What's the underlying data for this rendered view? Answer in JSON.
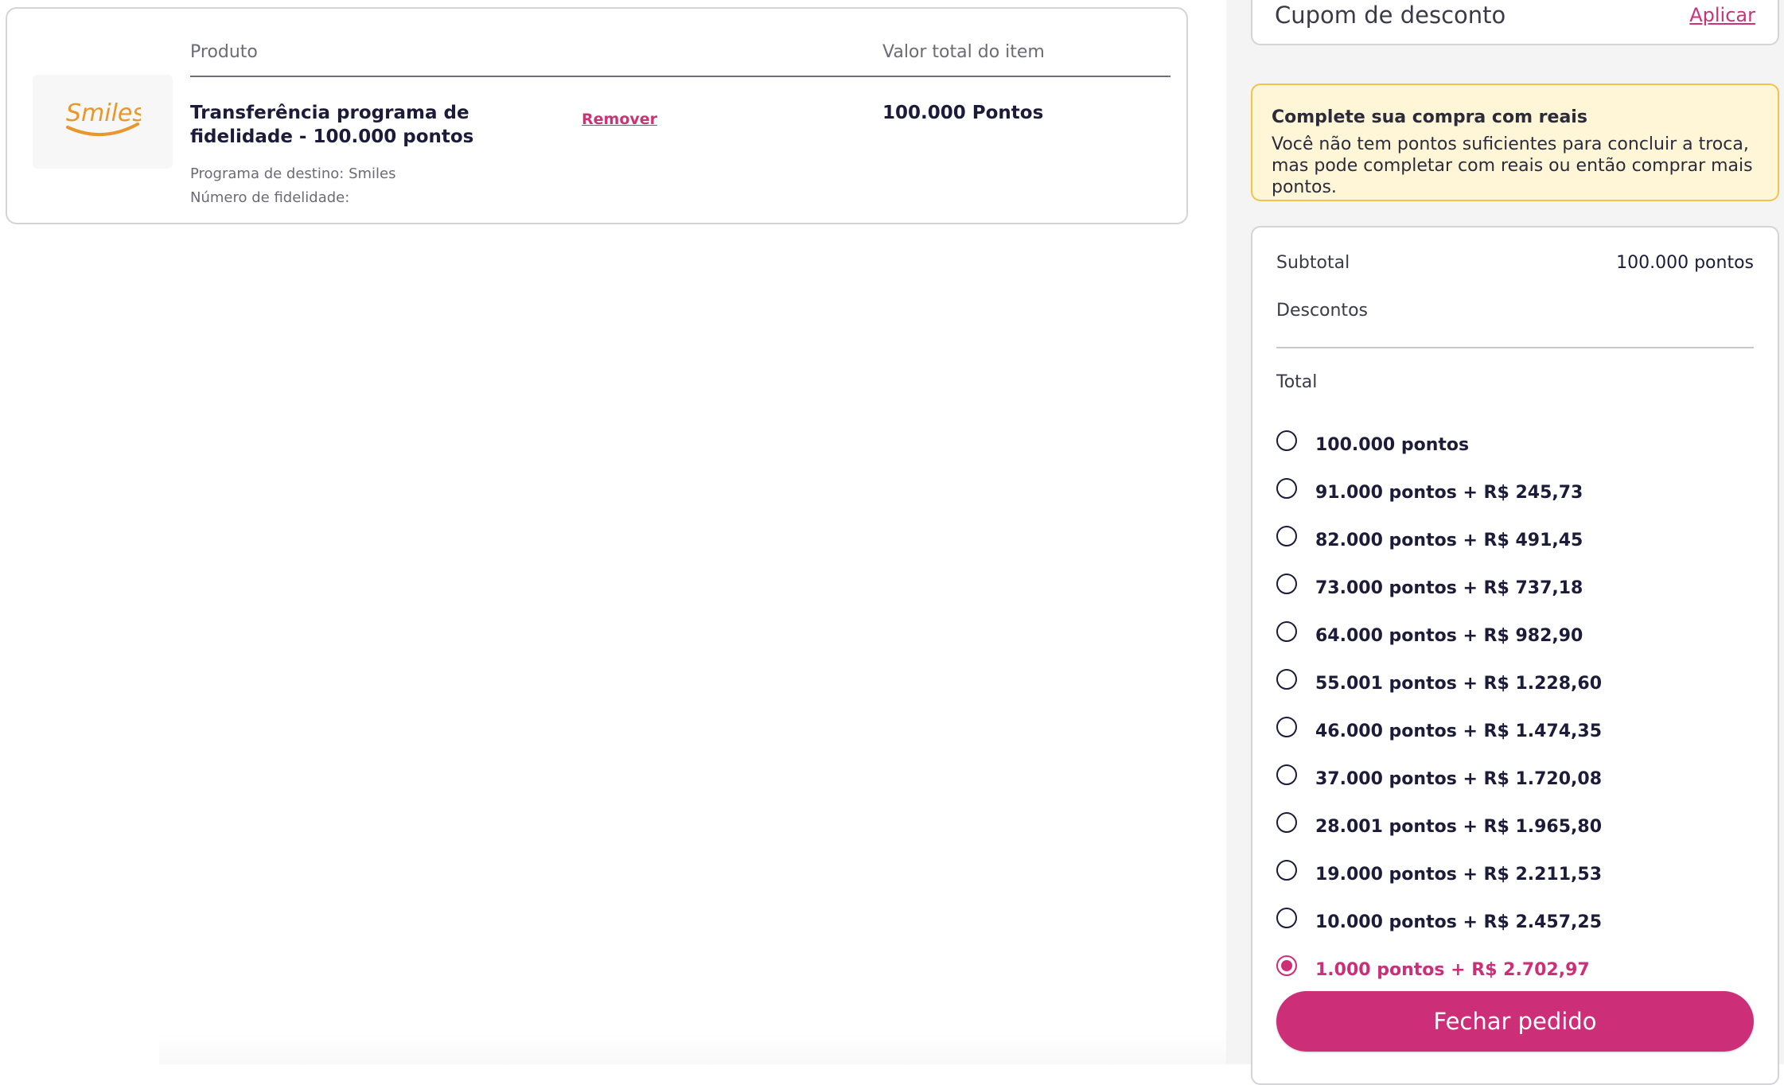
{
  "cart": {
    "headers": {
      "product": "Produto",
      "item_total": "Valor total do item"
    },
    "item": {
      "logo_text": "Smiles",
      "name": "Transferência programa de fidelidade - 100.000 pontos",
      "remove_label": "Remover",
      "value": "100.000 Pontos",
      "destination": "Programa de destino: Smiles",
      "loyalty_number": "Número de fidelidade:"
    }
  },
  "coupon": {
    "label": "Cupom de desconto",
    "apply_label": "Aplicar"
  },
  "alert": {
    "title": "Complete sua compra com reais",
    "text": "Você não tem pontos suficientes para concluir a troca, mas pode completar com reais ou então comprar mais pontos."
  },
  "summary": {
    "subtotal_label": "Subtotal",
    "subtotal_value": "100.000 pontos",
    "discounts_label": "Descontos",
    "total_label": "Total",
    "options": [
      {
        "label": "100.000 pontos",
        "selected": false
      },
      {
        "label": "91.000 pontos + R$ 245,73",
        "selected": false
      },
      {
        "label": "82.000 pontos + R$ 491,45",
        "selected": false
      },
      {
        "label": "73.000 pontos + R$ 737,18",
        "selected": false
      },
      {
        "label": "64.000 pontos + R$ 982,90",
        "selected": false
      },
      {
        "label": "55.001 pontos + R$ 1.228,60",
        "selected": false
      },
      {
        "label": "46.000 pontos + R$ 1.474,35",
        "selected": false
      },
      {
        "label": "37.000 pontos + R$ 1.720,08",
        "selected": false
      },
      {
        "label": "28.001 pontos + R$ 1.965,80",
        "selected": false
      },
      {
        "label": "19.000 pontos + R$ 2.211,53",
        "selected": false
      },
      {
        "label": "10.000 pontos + R$ 2.457,25",
        "selected": false
      },
      {
        "label": "1.000 pontos + R$ 2.702,97",
        "selected": true
      }
    ],
    "close_order_label": "Fechar pedido"
  },
  "colors": {
    "accent": "#cc2e78",
    "alert_bg": "#fff6d8",
    "alert_border": "#f3c24a",
    "logo": "#e8972a"
  }
}
